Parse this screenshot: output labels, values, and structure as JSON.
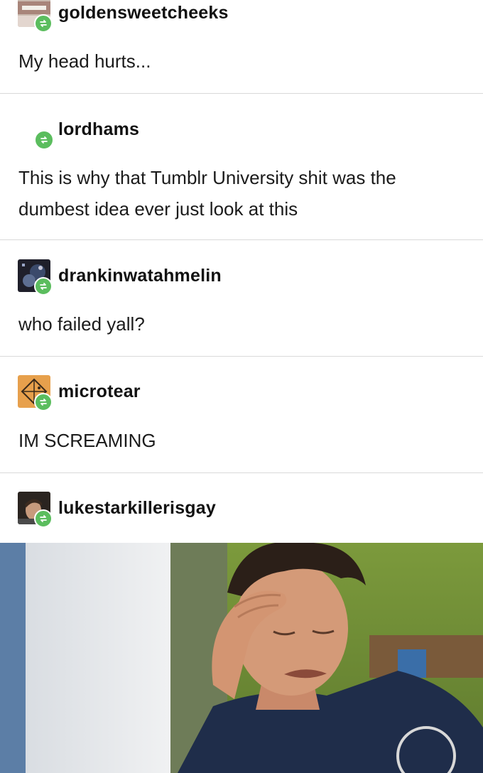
{
  "posts": [
    {
      "username": "goldensweetcheeks",
      "text": "My head hurts..."
    },
    {
      "username": "lordhams",
      "text": "This is why that Tumblr University shit was the dumbest idea ever just look at this"
    },
    {
      "username": "drankinwatahmelin",
      "text": "who failed yall?"
    },
    {
      "username": "microtear",
      "text": "IM SCREAMING"
    },
    {
      "username": "lukestarkillerisgay",
      "text": ""
    }
  ],
  "icons": {
    "reblog": "reblog-icon"
  },
  "colors": {
    "reblog_badge": "#5bbd5e",
    "divider": "#d9d9d9",
    "text": "#1b1b1b"
  }
}
